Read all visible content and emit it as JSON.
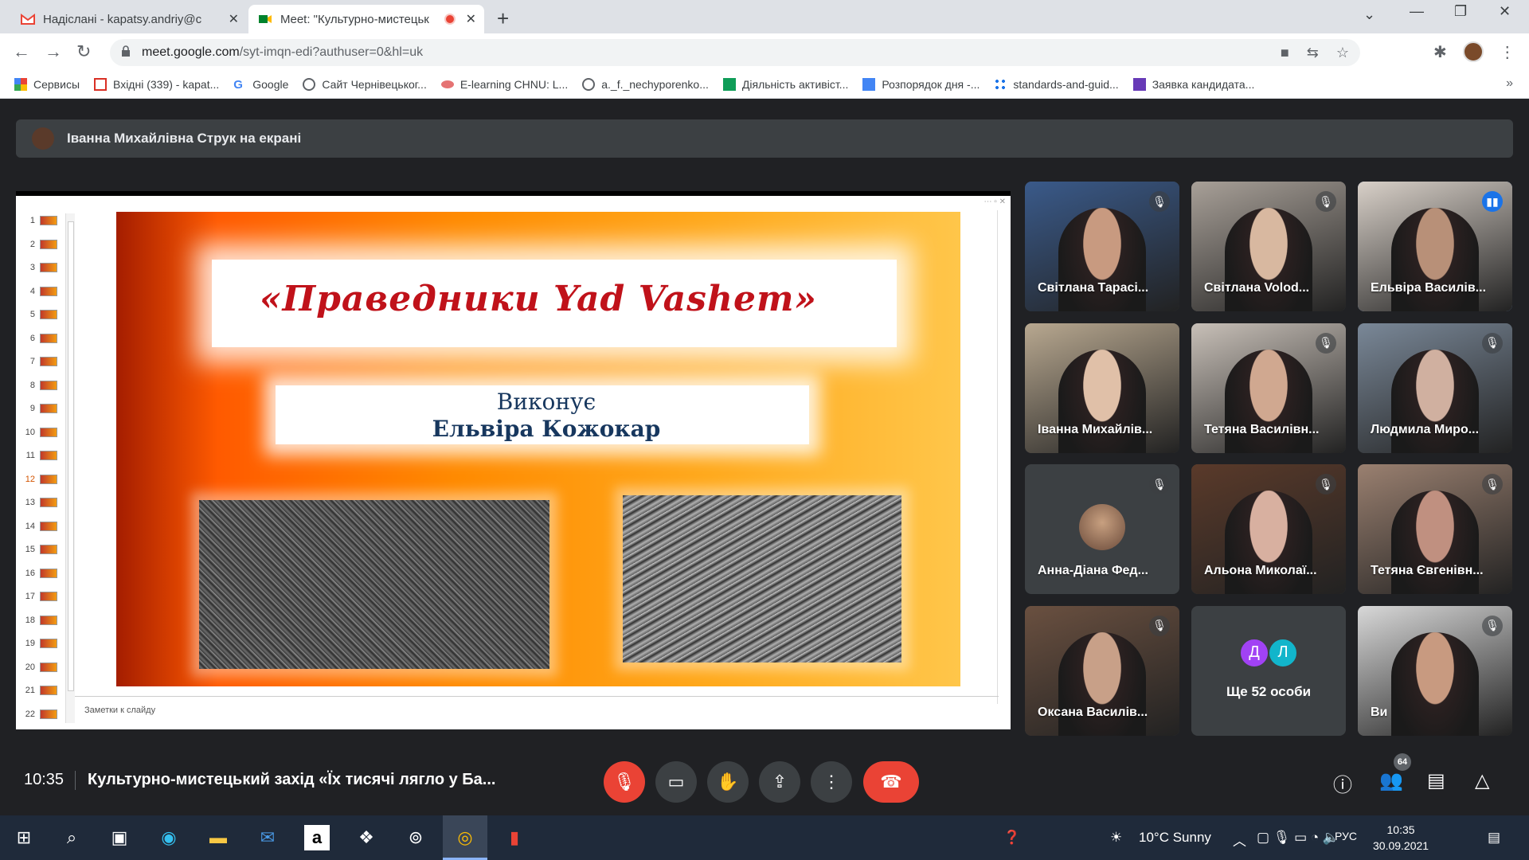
{
  "tabs": [
    {
      "title": "Надіслані - kapatsy.andriy@chnu",
      "icon": "gmail-icon"
    },
    {
      "title": "Meet: \"Культурно-мистецьк",
      "icon": "meet-icon"
    }
  ],
  "address": {
    "host": "meet.google.com",
    "path": "/syt-imqn-edi?authuser=0&hl=uk"
  },
  "bookmarks": [
    {
      "label": "Сервисы",
      "color": "#ea4335"
    },
    {
      "label": "Вхідні (339) - kapat...",
      "color": "#d93025"
    },
    {
      "label": "Google",
      "color": "#4285f4"
    },
    {
      "label": "Сайт Чернівецьког...",
      "color": "#5f6368"
    },
    {
      "label": "E-learning CHNU: L...",
      "color": "#e57373"
    },
    {
      "label": "a._f._nechyporenko...",
      "color": "#5f6368"
    },
    {
      "label": "Діяльність активіст...",
      "color": "#0f9d58"
    },
    {
      "label": "Розпорядок дня -...",
      "color": "#4285f4"
    },
    {
      "label": "standards-and-guid...",
      "color": "#1a73e8"
    },
    {
      "label": "Заявка кандидата...",
      "color": "#673ab7"
    }
  ],
  "banner": {
    "text": "Іванна Михайлівна Струк на екрані"
  },
  "slide": {
    "title": "«Праведники Yad Vashem»",
    "subtitle1": "Виконує",
    "subtitle2": "Ельвіра Кожокар",
    "notes_placeholder": "Заметки к слайду",
    "thumb_numbers": [
      "1",
      "2",
      "3",
      "4",
      "5",
      "6",
      "7",
      "8",
      "9",
      "10",
      "11",
      "12",
      "13",
      "14",
      "15",
      "16",
      "17",
      "18",
      "19",
      "20",
      "21",
      "22"
    ],
    "selected": "12"
  },
  "participants": [
    {
      "name": "Світлана Тарасі...",
      "muted": true,
      "bg": "#3a5a8a",
      "skin": "#c89a80"
    },
    {
      "name": "Світлана Volod...",
      "muted": true,
      "bg": "#a8a098",
      "skin": "#d8b8a0"
    },
    {
      "name": "Ельвіра Василів...",
      "muted": false,
      "speaking": true,
      "bg": "#d8d0c8",
      "skin": "#b89078"
    },
    {
      "name": "Іванна Михайлів...",
      "muted": false,
      "bg": "#b8a890",
      "skin": "#e0c0a8"
    },
    {
      "name": "Тетяна Василівн...",
      "muted": true,
      "bg": "#c8c0b8",
      "skin": "#d0a890"
    },
    {
      "name": "Людмила Миро...",
      "muted": true,
      "bg": "#7a8898",
      "skin": "#d0b0a0"
    },
    {
      "name": "Анна-Діана Фед...",
      "muted": true,
      "avatar": true
    },
    {
      "name": "Альона Миколаї...",
      "muted": true,
      "bg": "#5a3a2a",
      "skin": "#d8b0a0"
    },
    {
      "name": "Тетяна Євгенівн...",
      "muted": true,
      "bg": "#9a8070",
      "skin": "#c09080"
    },
    {
      "name": "Оксана Василів...",
      "muted": true,
      "bg": "#6a5040",
      "skin": "#c8a088"
    },
    {
      "name": "Ще 52 особи",
      "more": true,
      "initials": [
        "Д",
        "Л"
      ]
    },
    {
      "name": "Ви",
      "muted": true,
      "bg": "#d8d8d8",
      "skin": "#c89a80"
    }
  ],
  "controls": {
    "time": "10:35",
    "meeting_title": "Культурно-мистецький захід «Їх тисячі лягло у Ба...",
    "participants_count": "64"
  },
  "taskbar": {
    "weather": "10°C  Sunny",
    "lang": "РУС",
    "clock_time": "10:35",
    "clock_date": "30.09.2021"
  },
  "colors": {
    "accent": "#1a73e8",
    "danger": "#ea4335",
    "meet_bg": "#202124"
  }
}
